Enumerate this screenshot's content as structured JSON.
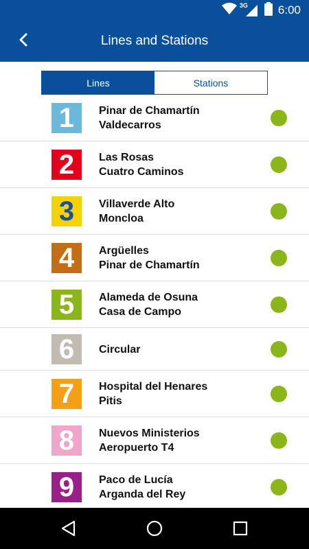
{
  "status_bar": {
    "time": "6:00",
    "network": "3G",
    "icons": [
      "wifi-icon",
      "cell-signal-icon",
      "battery-icon"
    ]
  },
  "app_bar": {
    "title": "Lines and Stations",
    "back_icon": "chevron-left-icon"
  },
  "tabs": {
    "lines": "Lines",
    "stations": "Stations",
    "selected": "Lines"
  },
  "colors": {
    "primary": "#0a4f9c",
    "status_ok": "#8ab61c"
  },
  "lines": [
    {
      "number": "1",
      "line1": "Pinar de Chamartín",
      "line2": "Valdecarros",
      "color": "#6cb8db",
      "status": "ok"
    },
    {
      "number": "2",
      "line1": "Las Rosas",
      "line2": "Cuatro Caminos",
      "color": "#e2001a",
      "status": "ok"
    },
    {
      "number": "3",
      "line1": "Villaverde Alto",
      "line2": "Moncloa",
      "color": "#f6d300",
      "status": "ok"
    },
    {
      "number": "4",
      "line1": "Argüelles",
      "line2": "Pinar de Chamartín",
      "color": "#c36d16",
      "status": "ok"
    },
    {
      "number": "5",
      "line1": "Alameda de Osuna",
      "line2": "Casa de Campo",
      "color": "#8ab61c",
      "status": "ok"
    },
    {
      "number": "6",
      "line1": "Circular",
      "line2": "",
      "color": "#c2bbb2",
      "status": "ok"
    },
    {
      "number": "7",
      "line1": "Hospital del Henares",
      "line2": "Pitis",
      "color": "#f39f18",
      "status": "ok"
    },
    {
      "number": "8",
      "line1": "Nuevos Ministerios",
      "line2": "Aeropuerto T4",
      "color": "#f0a6cb",
      "status": "ok"
    },
    {
      "number": "9",
      "line1": "Paco de Lucía",
      "line2": "Arganda del Rey",
      "color": "#9a1f86",
      "status": "ok"
    }
  ],
  "nav_bar": {
    "buttons": [
      "back-triangle-icon",
      "home-circle-icon",
      "recents-square-icon"
    ]
  }
}
